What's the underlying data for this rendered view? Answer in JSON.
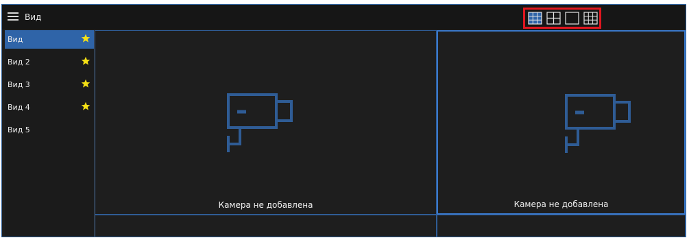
{
  "app": {
    "title": "Вид"
  },
  "layout_switcher": {
    "options": [
      {
        "icon": "grid-3x3-icon",
        "active": true
      },
      {
        "icon": "grid-2x2-icon",
        "active": false
      },
      {
        "icon": "single-view-icon",
        "active": false
      },
      {
        "icon": "grid-3x3-outline-icon",
        "active": false
      }
    ],
    "highlight_color": "#e0161f"
  },
  "sidebar": {
    "items": [
      {
        "label": "Вид",
        "favorite": true,
        "active": true
      },
      {
        "label": "Вид 2",
        "favorite": true,
        "active": false
      },
      {
        "label": "Вид 3",
        "favorite": true,
        "active": false
      },
      {
        "label": "Вид 4",
        "favorite": true,
        "active": false
      },
      {
        "label": "Вид 5",
        "favorite": false,
        "active": false
      }
    ]
  },
  "grid": {
    "cells": [
      {
        "caption": "Камера не добавлена",
        "selected": false
      },
      {
        "caption": "Камера не добавлена",
        "selected": true
      }
    ]
  },
  "colors": {
    "accent": "#2f64a8",
    "camera_icon": "#2f5c95",
    "star": "#f5e015",
    "background": "#1e1e1e"
  }
}
